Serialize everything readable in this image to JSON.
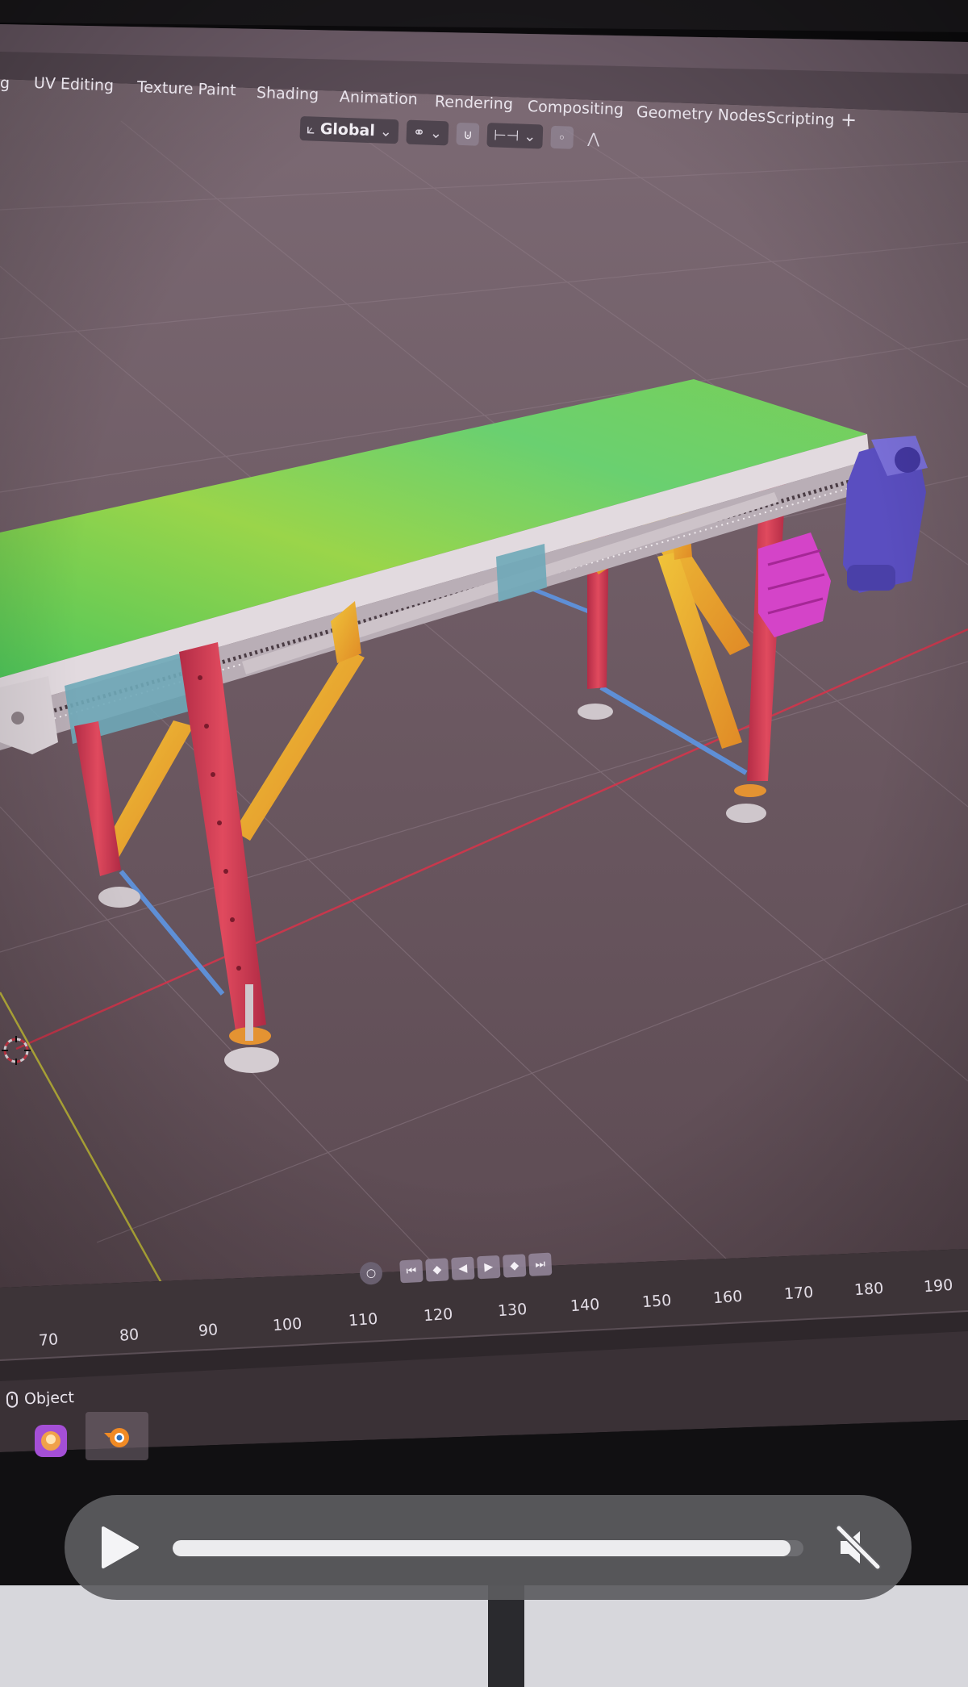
{
  "colors": {
    "viewport_bg": "#6a5760",
    "belt": "#68c84e",
    "legs": "#d2394e",
    "braces": "#e8b228",
    "motor": "#5a4ec0",
    "gearbox_block": "#d444c8",
    "x_axis": "#d9334a",
    "y_axis": "#c9c23a"
  },
  "workspace_tabs": [
    {
      "label": "g"
    },
    {
      "label": "UV Editing"
    },
    {
      "label": "Texture Paint"
    },
    {
      "label": "Shading"
    },
    {
      "label": "Animation"
    },
    {
      "label": "Rendering"
    },
    {
      "label": "Compositing"
    },
    {
      "label": "Geometry Nodes"
    },
    {
      "label": "Scripting"
    },
    {
      "label": "+"
    }
  ],
  "header_tools": {
    "orientation_label": "Global"
  },
  "timeline": {
    "frame_numbers": [
      "70",
      "80",
      "90",
      "100",
      "110",
      "120",
      "130",
      "140",
      "150",
      "160",
      "170",
      "180",
      "190"
    ]
  },
  "status_bar": {
    "mode_label": "Object"
  },
  "taskbar_apps": [
    {
      "icon": "app-icon"
    },
    {
      "icon": "blender-icon"
    }
  ],
  "video_controls": {
    "progress": 0.98,
    "muted": true
  }
}
